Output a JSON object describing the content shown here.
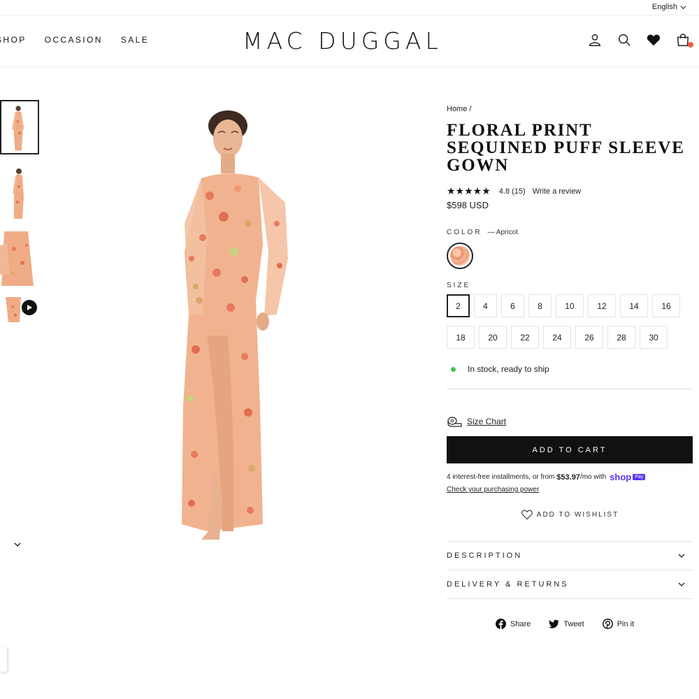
{
  "topbar": {
    "language": "English"
  },
  "header": {
    "nav": [
      "SHOP",
      "OCCASION",
      "SALE"
    ],
    "logo": "MAC DUGGAL"
  },
  "icons": [
    "account-icon",
    "search-icon",
    "heart-icon",
    "cart-icon",
    "chevron-down-icon",
    "play-icon",
    "size-chart-icon",
    "facebook-icon",
    "twitter-icon",
    "pinterest-icon"
  ],
  "product": {
    "breadcrumb": "Home /",
    "title_lines": [
      "FLORAL PRINT",
      "SEQUINED PUFF SLEEVE",
      "GOWN"
    ],
    "stars": "★★★★★",
    "rating": "4.8",
    "review_count": "(15)",
    "write_review": "Write a review",
    "price": "$598 USD",
    "color_label": "COLOR",
    "color_value": "— Apricot",
    "size_label": "SIZE",
    "sizes": [
      "2",
      "4",
      "6",
      "8",
      "10",
      "12",
      "14",
      "16",
      "18",
      "20",
      "22",
      "24",
      "26",
      "28",
      "30"
    ],
    "selected_size": "2",
    "stock": "In stock, ready to ship",
    "size_chart": "Size Chart",
    "add_to_cart": "ADD TO CART",
    "installments_pre": "4 interest-free installments, or from",
    "installments_amount": "$53.97",
    "installments_post": "/mo with",
    "shop_pay": "shop",
    "shop_pay_badge": "Pay",
    "check_power": "Check your purchasing power",
    "wishlist": "ADD TO WISHLIST",
    "accordions": [
      "DESCRIPTION",
      "DELIVERY & RETURNS"
    ],
    "share": [
      "Share",
      "Tweet",
      "Pin it"
    ]
  },
  "colors": {
    "text": "#111111",
    "stock_dot": "#44c252",
    "cart_dot": "#f05a3c",
    "shop_pay": "#5a31f4",
    "button_bg": "#111111"
  }
}
